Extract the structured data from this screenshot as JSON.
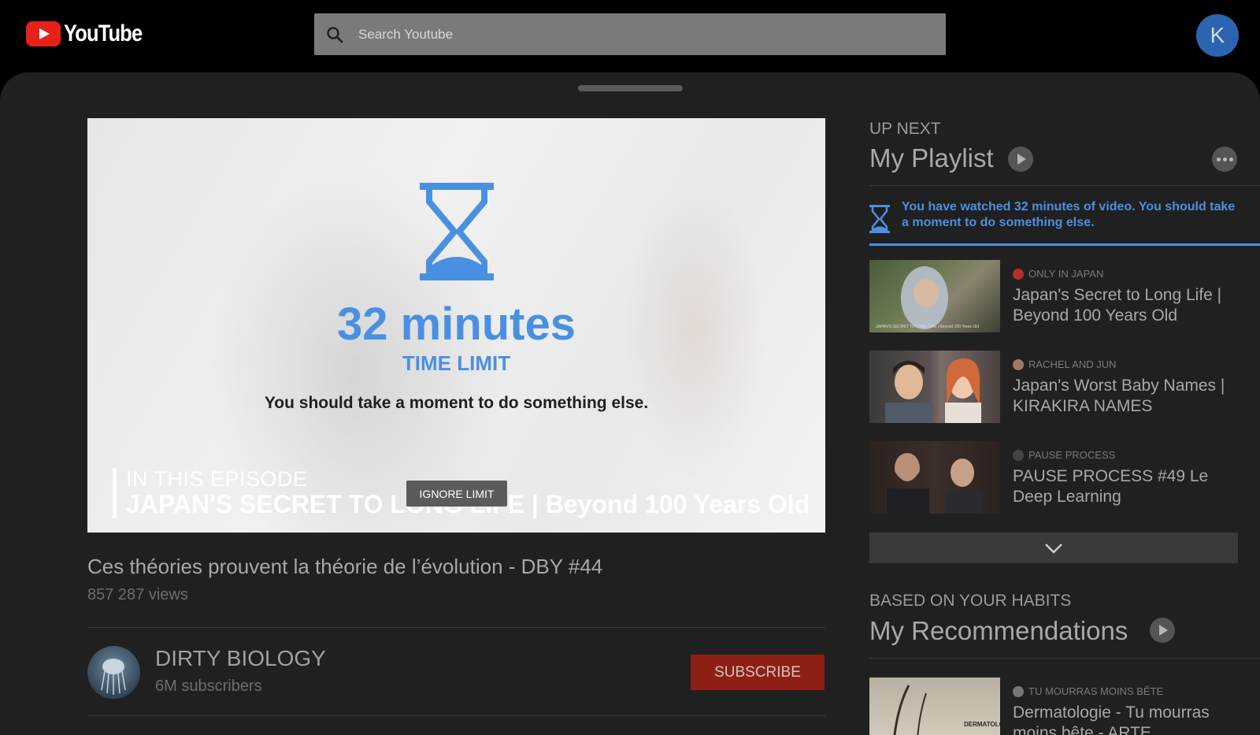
{
  "header": {
    "logo_text": "YouTube",
    "search_placeholder": "Search Youtube",
    "avatar_initial": "K"
  },
  "player": {
    "minutes": "32 minutes",
    "limit_label": "TIME LIMIT",
    "message": "You should take a moment to do something else.",
    "episode_label": "IN THIS EPISODE",
    "episode_title": "JAPAN'S SECRET TO LONG LIFE | Beyond 100 Years Old",
    "ignore_label": "IGNORE LIMIT"
  },
  "video": {
    "title": "Ces théories prouvent la théorie de l’évolution - DBY #44",
    "views": "857 287 views",
    "channel": "DIRTY BIOLOGY",
    "subscribers": "6M subscribers",
    "subscribe_label": "SUBSCRIBE"
  },
  "up_next": {
    "label": "UP NEXT",
    "title": "My Playlist",
    "notice": "You have watched 32 minutes of video. You should take a moment to do something else.",
    "accent_color": "#4a90e2",
    "items": [
      {
        "channel": "ONLY IN JAPAN",
        "title": "Japan's Secret to Long Life | Beyond 100 Years Old",
        "thumb_caption": "JAPAN'S SECRET TO LONG LIFE | Beyond 100 Years Old"
      },
      {
        "channel": "RACHEL AND JUN",
        "title": "Japan's Worst Baby Names | KIRAKIRA NAMES"
      },
      {
        "channel": "PAUSE PROCESS",
        "title": "PAUSE PROCESS #49 Le Deep Learning"
      }
    ]
  },
  "recommendations": {
    "label": "BASED ON YOUR HABITS",
    "title": "My Recommendations",
    "items": [
      {
        "channel": "TU MOURRAS MOINS BÊTE",
        "title": "Dermatologie - Tu mourras moins bête - ARTE",
        "thumb_caption": "DERMATOLOGIE"
      }
    ]
  }
}
